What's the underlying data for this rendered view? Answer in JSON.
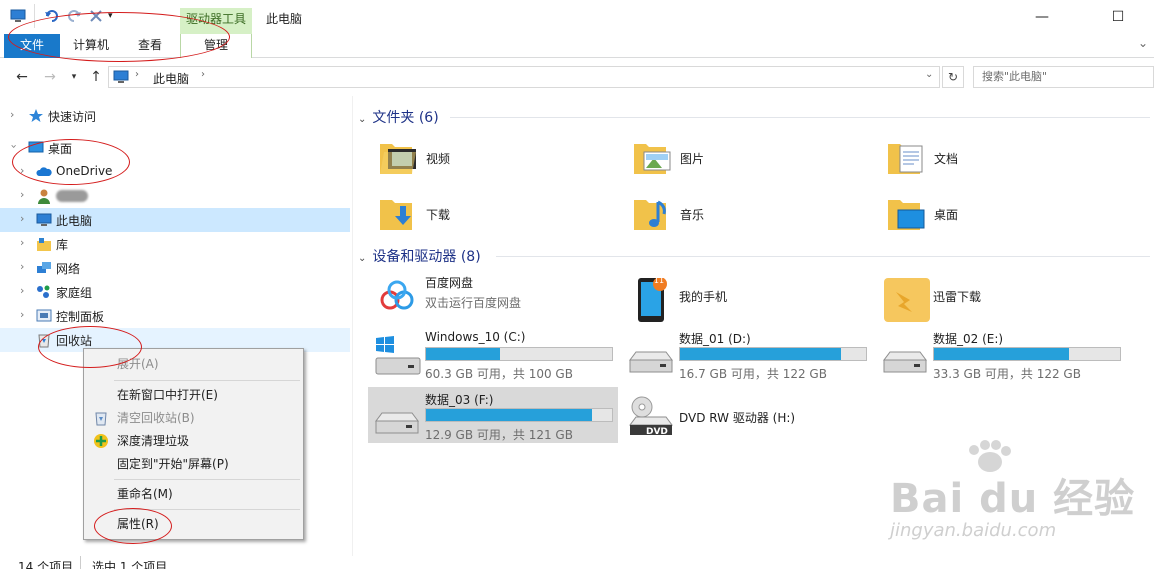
{
  "window": {
    "title": "此电脑",
    "context_tab": "驱动器工具",
    "minimize": "—",
    "maximize": "☐",
    "close": "✕"
  },
  "ribbon": {
    "tabs": [
      "文件",
      "计算机",
      "查看",
      "管理"
    ],
    "expand_caret": "⌄"
  },
  "address": {
    "path": [
      "此电脑"
    ],
    "search_placeholder": "搜索\"此电脑\""
  },
  "nav_tree": [
    {
      "label": "快速访问",
      "icon": "star-icon",
      "expanded": false
    },
    {
      "label": "桌面",
      "icon": "desktop-icon",
      "expanded": true
    },
    {
      "label": "OneDrive",
      "icon": "cloud-icon",
      "expanded": false
    },
    {
      "label": "",
      "icon": "user-icon",
      "expanded": false,
      "blurred": true
    },
    {
      "label": "此电脑",
      "icon": "computer-icon",
      "expanded": false,
      "selected": true
    },
    {
      "label": "库",
      "icon": "library-icon",
      "expanded": false
    },
    {
      "label": "网络",
      "icon": "network-icon",
      "expanded": false
    },
    {
      "label": "家庭组",
      "icon": "homegroup-icon",
      "expanded": false
    },
    {
      "label": "控制面板",
      "icon": "control-panel-icon",
      "expanded": false
    },
    {
      "label": "回收站",
      "icon": "recycle-bin-icon",
      "expanded": false,
      "highlighted": true
    }
  ],
  "folders_group": {
    "title": "文件夹 (6)",
    "items": [
      {
        "label": "视频",
        "icon": "videos-folder-icon"
      },
      {
        "label": "图片",
        "icon": "pictures-folder-icon"
      },
      {
        "label": "文档",
        "icon": "documents-folder-icon"
      },
      {
        "label": "下载",
        "icon": "downloads-folder-icon"
      },
      {
        "label": "音乐",
        "icon": "music-folder-icon"
      },
      {
        "label": "桌面",
        "icon": "desktop-folder-icon"
      }
    ]
  },
  "devices_group": {
    "title": "设备和驱动器 (8)",
    "items": [
      {
        "name": "百度网盘",
        "sub": "双击运行百度网盘",
        "icon": "baidu-netdisk-icon"
      },
      {
        "name": "我的手机",
        "icon": "phone-icon",
        "badge": "11"
      },
      {
        "name": "迅雷下载",
        "icon": "thunder-folder-icon"
      },
      {
        "name": "Windows_10 (C:)",
        "stats": "60.3 GB 可用，共 100 GB",
        "used_fraction": 0.397,
        "icon": "windows-drive-icon"
      },
      {
        "name": "数据_01 (D:)",
        "stats": "16.7 GB 可用，共 122 GB",
        "used_fraction": 0.863,
        "icon": "drive-icon"
      },
      {
        "name": "数据_02 (E:)",
        "stats": "33.3 GB 可用，共 122 GB",
        "used_fraction": 0.727,
        "icon": "drive-icon"
      },
      {
        "name": "数据_03 (F:)",
        "stats": "12.9 GB 可用，共 121 GB",
        "used_fraction": 0.893,
        "icon": "drive-icon",
        "selected": true
      },
      {
        "name": "DVD RW 驱动器 (H:)",
        "icon": "dvd-drive-icon",
        "dvd_label": "DVD"
      }
    ]
  },
  "context_menu": [
    {
      "label": "展开(A)",
      "disabled": true
    },
    {
      "separator": true
    },
    {
      "label": "在新窗口中打开(E)"
    },
    {
      "label": "清空回收站(B)",
      "disabled": true,
      "icon": "recycle-icon"
    },
    {
      "label": "深度清理垃圾",
      "icon": "clean-icon"
    },
    {
      "label": "固定到\"开始\"屏幕(P)"
    },
    {
      "separator": true
    },
    {
      "label": "重命名(M)"
    },
    {
      "separator": true
    },
    {
      "label": "属性(R)"
    }
  ],
  "status": {
    "count": "14 个项目",
    "selected": "选中 1 个项目"
  },
  "watermark": {
    "logo": "Bai du 经验",
    "url": "jingyan.baidu.com"
  },
  "colors": {
    "accent": "#1979ca",
    "selection": "#cce8ff",
    "drive_fill": "#26a0da",
    "annotation": "#d41c1c"
  }
}
